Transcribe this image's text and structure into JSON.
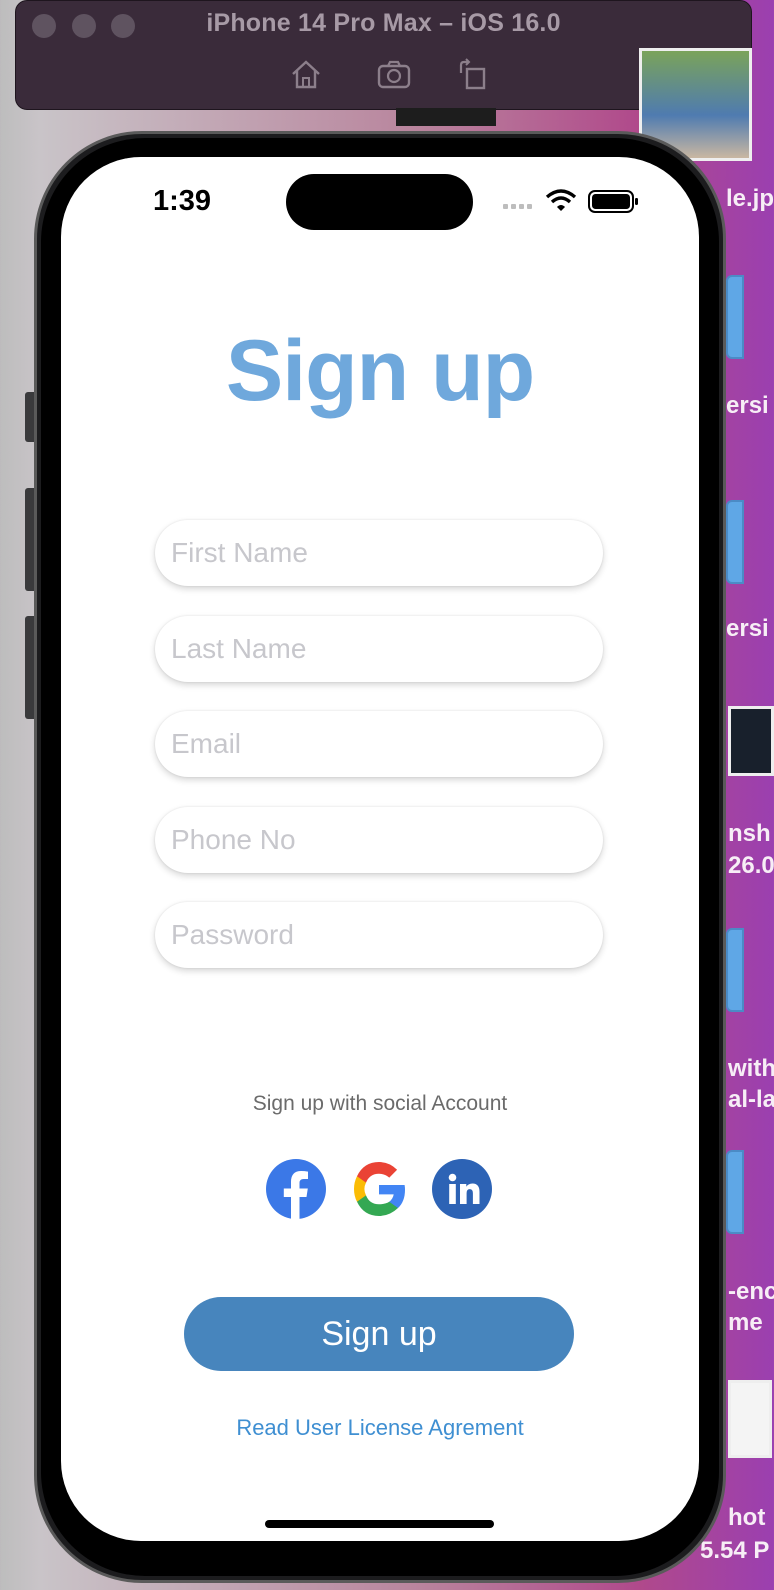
{
  "simulator": {
    "title": "iPhone 14 Pro Max – iOS 16.0",
    "toolbar_icons": [
      "home-icon",
      "screenshot-icon",
      "rotate-icon"
    ]
  },
  "desktop": {
    "labels": [
      "le.jp",
      "ersi",
      "ersi",
      "nsh",
      "26.0",
      "with",
      "al-la",
      "-enc",
      "me",
      "hot",
      "5.54 P"
    ]
  },
  "status_bar": {
    "time": "1:39",
    "icons": [
      "signal-icon",
      "wifi-icon",
      "battery-icon"
    ]
  },
  "form": {
    "title": "Sign up",
    "fields": [
      {
        "placeholder": "First Name",
        "value": ""
      },
      {
        "placeholder": "Last Name",
        "value": ""
      },
      {
        "placeholder": "Email",
        "value": ""
      },
      {
        "placeholder": "Phone No",
        "value": ""
      },
      {
        "placeholder": "Password",
        "value": ""
      }
    ]
  },
  "social": {
    "caption": "Sign up with social Account",
    "providers": [
      "facebook-icon",
      "google-icon",
      "linkedin-icon"
    ]
  },
  "actions": {
    "signup_label": "Sign up",
    "license_link": "Read User License Agrement"
  },
  "colors": {
    "title": "#6fa8dc",
    "button": "#4785bd",
    "link": "#3f8fd2",
    "facebook": "#3b78e7",
    "linkedin": "#2d63b5"
  }
}
